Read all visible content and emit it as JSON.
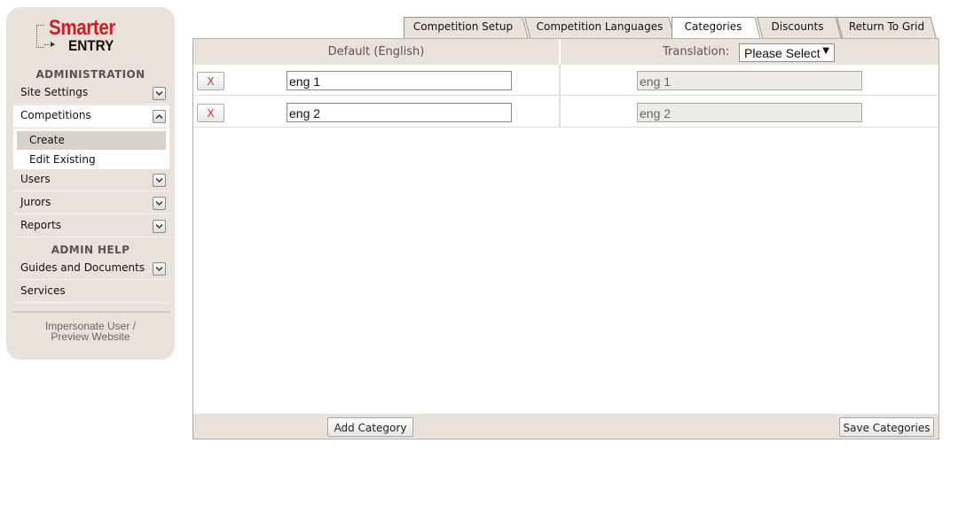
{
  "logo": {
    "line1": "Smarter",
    "line2": "ENTRY"
  },
  "sidebar": {
    "admin_heading": "ADMINISTRATION",
    "items": [
      {
        "label": "Site Settings",
        "icon": "chevron-down-icon"
      },
      {
        "label": "Competitions",
        "icon": "chevron-up-icon",
        "expanded": true
      },
      {
        "label": "Users",
        "icon": "chevron-down-icon"
      },
      {
        "label": "Jurors",
        "icon": "chevron-down-icon"
      },
      {
        "label": "Reports",
        "icon": "chevron-down-icon"
      }
    ],
    "submenu": [
      {
        "label": "Create",
        "active": true
      },
      {
        "label": "Edit Existing"
      }
    ],
    "help_heading": "ADMIN HELP",
    "help_items": [
      {
        "label": "Guides and Documents",
        "icon": "chevron-down-icon"
      },
      {
        "label": "Services"
      }
    ],
    "impersonate_line1": "Impersonate User /",
    "impersonate_line2": "Preview Website"
  },
  "tabs": [
    {
      "label": "Competition Setup"
    },
    {
      "label": "Competition Languages"
    },
    {
      "label": "Categories",
      "active": true
    },
    {
      "label": "Discounts"
    },
    {
      "label": "Return To Grid"
    }
  ],
  "panel": {
    "default_heading": "Default (English)",
    "translation_label": "Translation:",
    "translation_select": "Please Select",
    "rows": [
      {
        "remove": "X",
        "value": "eng 1",
        "translation": "eng 1"
      },
      {
        "remove": "X",
        "value": "eng 2",
        "translation": "eng 2"
      }
    ],
    "add_button": "Add Category",
    "save_button": "Save Categories"
  },
  "colors": {
    "sidebar_bg": "#e8e2da",
    "brand_red": "#cc1f1f",
    "remove_red": "#d03030"
  }
}
